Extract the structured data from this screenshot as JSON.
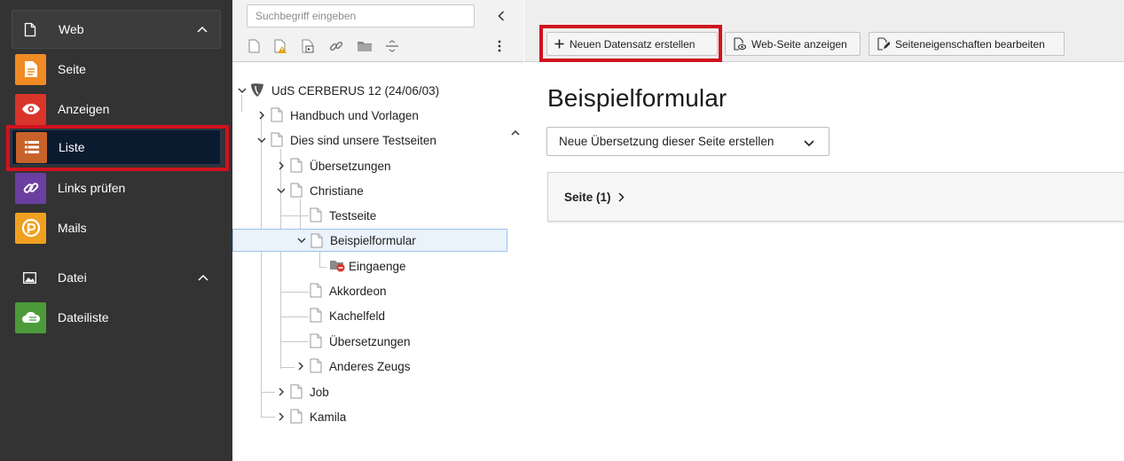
{
  "module_menu": {
    "groups": [
      {
        "label": "Web",
        "icon": "page-icon"
      },
      {
        "label": "Datei",
        "icon": "image-icon"
      }
    ],
    "items": [
      {
        "label": "Seite",
        "icon": "page-module-icon",
        "color": "#f08a24"
      },
      {
        "label": "Anzeigen",
        "icon": "eye-icon",
        "color": "#d9352b"
      },
      {
        "label": "Liste",
        "icon": "list-icon",
        "color": "#c8622a"
      },
      {
        "label": "Links prüfen",
        "icon": "link-check-icon",
        "color": "#6a3fa1"
      },
      {
        "label": "Mails",
        "icon": "mail-icon",
        "color": "#f0a020"
      },
      {
        "label": "Dateiliste",
        "icon": "file-cloud-icon",
        "color": "#4c9a3a"
      }
    ],
    "active_item": "Liste",
    "highlight_color": "#d0121f"
  },
  "page_tree": {
    "search_placeholder": "Suchbegriff eingeben",
    "toolbar_icons": [
      "new-page-icon",
      "new-page-warning-icon",
      "new-shortcut-icon",
      "link-icon",
      "folder-icon",
      "divider-icon"
    ],
    "root": {
      "label": "UdS CERBERUS 12 (24/06/03)",
      "icon": "typo3-icon"
    },
    "nodes": [
      {
        "label": "Handbuch und Vorlagen",
        "toggle": "collapsed"
      },
      {
        "label": "Dies sind unsere Testseiten",
        "toggle": "expanded"
      },
      {
        "label": "Übersetzungen",
        "toggle": "collapsed"
      },
      {
        "label": "Christiane",
        "toggle": "expanded"
      },
      {
        "label": "Testseite",
        "toggle": "none"
      },
      {
        "label": "Beispielformular",
        "toggle": "expanded",
        "selected": true
      },
      {
        "label": "Eingaenge",
        "toggle": "none",
        "icon": "folder-restricted-icon"
      },
      {
        "label": "Akkordeon",
        "toggle": "none"
      },
      {
        "label": "Kachelfeld",
        "toggle": "none"
      },
      {
        "label": "Übersetzungen",
        "toggle": "none"
      },
      {
        "label": "Anderes Zeugs",
        "toggle": "collapsed"
      },
      {
        "label": "Job",
        "toggle": "collapsed"
      },
      {
        "label": "Kamila",
        "toggle": "collapsed"
      }
    ]
  },
  "doc_header": {
    "buttons": [
      {
        "label": "Neuen Datensatz erstellen",
        "icon": "plus-icon"
      },
      {
        "label": "Web-Seite anzeigen",
        "icon": "view-page-icon"
      },
      {
        "label": "Seiteneigenschaften bearbeiten",
        "icon": "edit-page-icon"
      }
    ]
  },
  "content": {
    "title": "Beispielformular",
    "translation_select": "Neue Übersetzung dieser Seite erstellen",
    "record_panel": "Seite (1)"
  }
}
